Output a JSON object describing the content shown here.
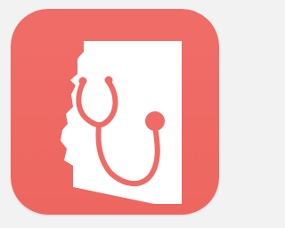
{
  "icon": {
    "name": "arizona-stethoscope-app-icon",
    "icon": "stethoscope-over-arizona-map",
    "colors": {
      "background": "#ef6b65",
      "foreground": "#ffffff",
      "outline": "#f08c89",
      "page": "#f2f2f2"
    }
  }
}
